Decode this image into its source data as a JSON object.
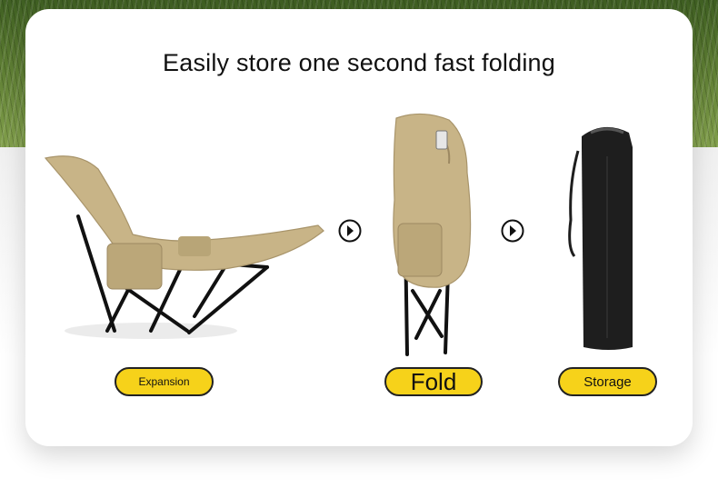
{
  "title": "Easily store one second fast folding",
  "steps": [
    {
      "label": "Expansion",
      "icon": "reclining-chair-open-icon"
    },
    {
      "label": "Fold",
      "icon": "chair-folded-icon"
    },
    {
      "label": "Storage",
      "icon": "storage-bag-icon"
    }
  ],
  "arrows": [
    "chevron-right-circle-icon",
    "chevron-right-circle-icon"
  ],
  "colors": {
    "pill": "#f6d21a",
    "canvas": "#c8b487",
    "frame": "#111111",
    "bag": "#1e1e1e"
  }
}
